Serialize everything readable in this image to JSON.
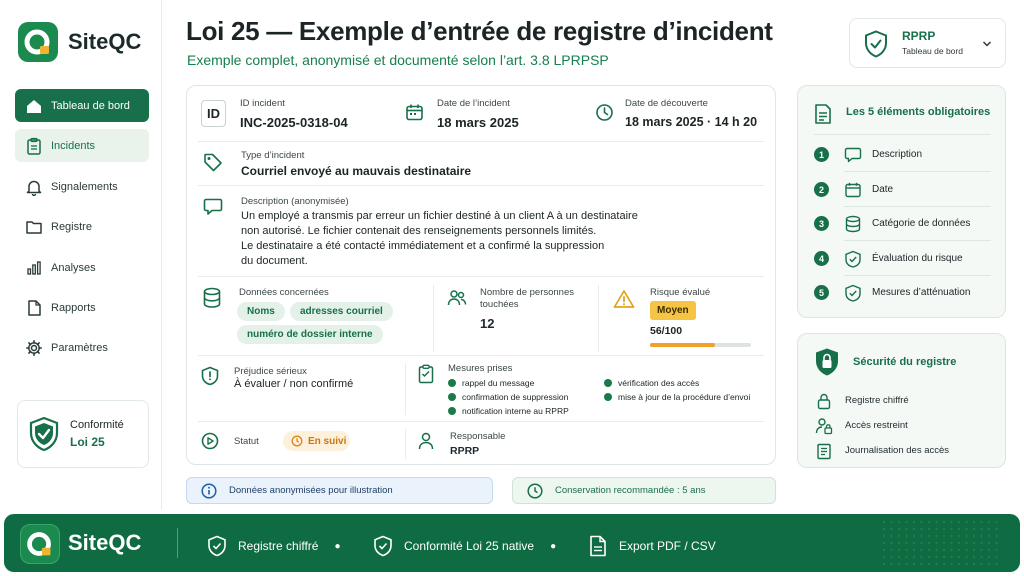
{
  "brand": {
    "name": "SiteQC"
  },
  "sidebar": {
    "items": [
      {
        "label": "Tableau de bord",
        "icon": "home-icon",
        "state": "active"
      },
      {
        "label": "Incidents",
        "icon": "clipboard-icon",
        "state": "selected"
      },
      {
        "label": "Signalements",
        "icon": "bell-icon",
        "state": ""
      },
      {
        "label": "Registre",
        "icon": "folder-icon",
        "state": ""
      },
      {
        "label": "Analyses",
        "icon": "bar-chart-icon",
        "state": ""
      },
      {
        "label": "Rapports",
        "icon": "document-icon",
        "state": ""
      },
      {
        "label": "Paramètres",
        "icon": "gear-icon",
        "state": ""
      }
    ],
    "compliance": {
      "line1": "Conformité",
      "line2": "Loi 25"
    }
  },
  "header": {
    "title": "Loi 25 — Exemple d’entrée de registre d’incident",
    "subtitle": "Exemple complet, anonymisé et documenté selon l’art. 3.8 LPRPSP"
  },
  "user": {
    "name": "RPRP",
    "role": "Tableau de bord"
  },
  "incident": {
    "id_badge": "ID",
    "id_label": "ID incident",
    "id_value": "INC-2025-0318-04",
    "date_label": "Date de l’incident",
    "date_value": "18 mars 2025",
    "discovery_label": "Date de découverte",
    "discovery_value": "18 mars 2025 · 14 h 20",
    "type_label": "Type d’incident",
    "type_value": "Courriel envoyé au mauvais destinataire",
    "description_label": "Description (anonymisée)",
    "description_lines": [
      "Un employé a transmis par erreur un fichier destiné à un client A à un destinataire",
      "non autorisé. Le fichier contenait des renseignements personnels limités.",
      "Le destinataire a été contacté immédiatement et a confirmé la suppression",
      "du document."
    ],
    "data_label": "Données concernées",
    "data_chips": [
      "Noms",
      "adresses courriel",
      "numéro de dossier interne"
    ],
    "persons_label_1": "Nombre de personnes",
    "persons_label_2": "touchées",
    "persons_value": "12",
    "risk_label": "Risque évalué",
    "risk_badge": "Moyen",
    "risk_score": "56/100",
    "risk_fraction": 0.56,
    "harm_label": "Préjudice sérieux",
    "harm_value": "À évaluer / non confirmé",
    "measures_label": "Mesures prises",
    "measures_left": [
      "rappel du message",
      "confirmation de suppression",
      "notification interne au RPRP"
    ],
    "measures_right": [
      "vérification des accès",
      "mise à jour de la procédure d’envoi"
    ],
    "status_label": "Statut",
    "status_value": "En suivi",
    "owner_label": "Responsable",
    "owner_value": "RPRP"
  },
  "notes": {
    "anonymized": "Données anonymisées pour illustration",
    "retention": "Conservation recommandée : 5 ans"
  },
  "mandatory": {
    "title": "Les 5 éléments obligatoires",
    "items": [
      {
        "n": "1",
        "label": "Description",
        "icon": "chat-bubble-icon"
      },
      {
        "n": "2",
        "label": "Date",
        "icon": "calendar-icon"
      },
      {
        "n": "3",
        "label": "Catégorie de données",
        "icon": "database-icon"
      },
      {
        "n": "4",
        "label": "Évaluation du risque",
        "icon": "shield-check-icon"
      },
      {
        "n": "5",
        "label": "Mesures d’atténuation",
        "icon": "shield-check-icon"
      }
    ]
  },
  "security": {
    "title": "Sécurité du registre",
    "items": [
      {
        "label": "Registre chiffré",
        "icon": "lock-icon"
      },
      {
        "label": "Accès restreint",
        "icon": "user-lock-icon"
      },
      {
        "label": "Journalisation des accès",
        "icon": "log-icon"
      }
    ]
  },
  "footer": {
    "brand": "SiteQC",
    "items": [
      "Registre chiffré",
      "Conformité Loi 25 native",
      "Export PDF / CSV"
    ]
  },
  "colors": {
    "primary": "#17704a",
    "accent": "#f2b233",
    "light": "#e9f3ec"
  }
}
